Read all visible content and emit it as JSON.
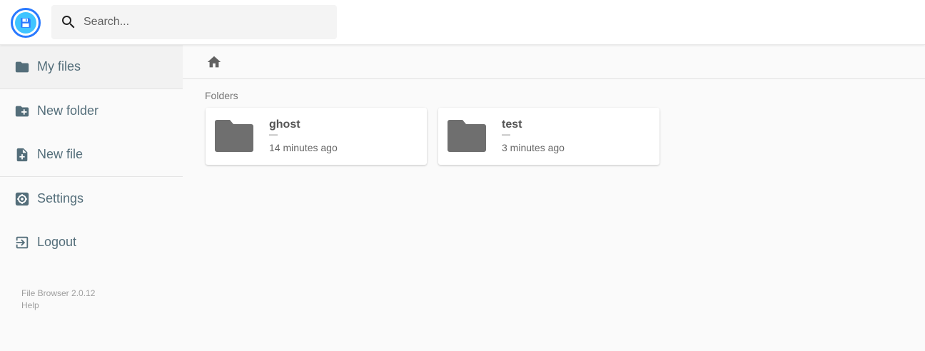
{
  "header": {
    "search_placeholder": "Search..."
  },
  "sidebar": {
    "items": [
      {
        "label": "My files",
        "icon": "folder-icon"
      },
      {
        "label": "New folder",
        "icon": "create-new-folder-icon"
      },
      {
        "label": "New file",
        "icon": "note-add-icon"
      },
      {
        "label": "Settings",
        "icon": "settings-icon"
      },
      {
        "label": "Logout",
        "icon": "exit-icon"
      }
    ],
    "footer": {
      "version": "File Browser 2.0.12",
      "help": "Help"
    }
  },
  "main": {
    "breadcrumb_icon": "home-icon",
    "section_title": "Folders",
    "folders": [
      {
        "name": "ghost",
        "size": "—",
        "modified": "14 minutes ago"
      },
      {
        "name": "test",
        "size": "—",
        "modified": "3 minutes ago"
      }
    ]
  },
  "colors": {
    "accent": "#2979ff",
    "sidebar_text": "#546e7a",
    "folder_icon": "#6f6f6f"
  }
}
